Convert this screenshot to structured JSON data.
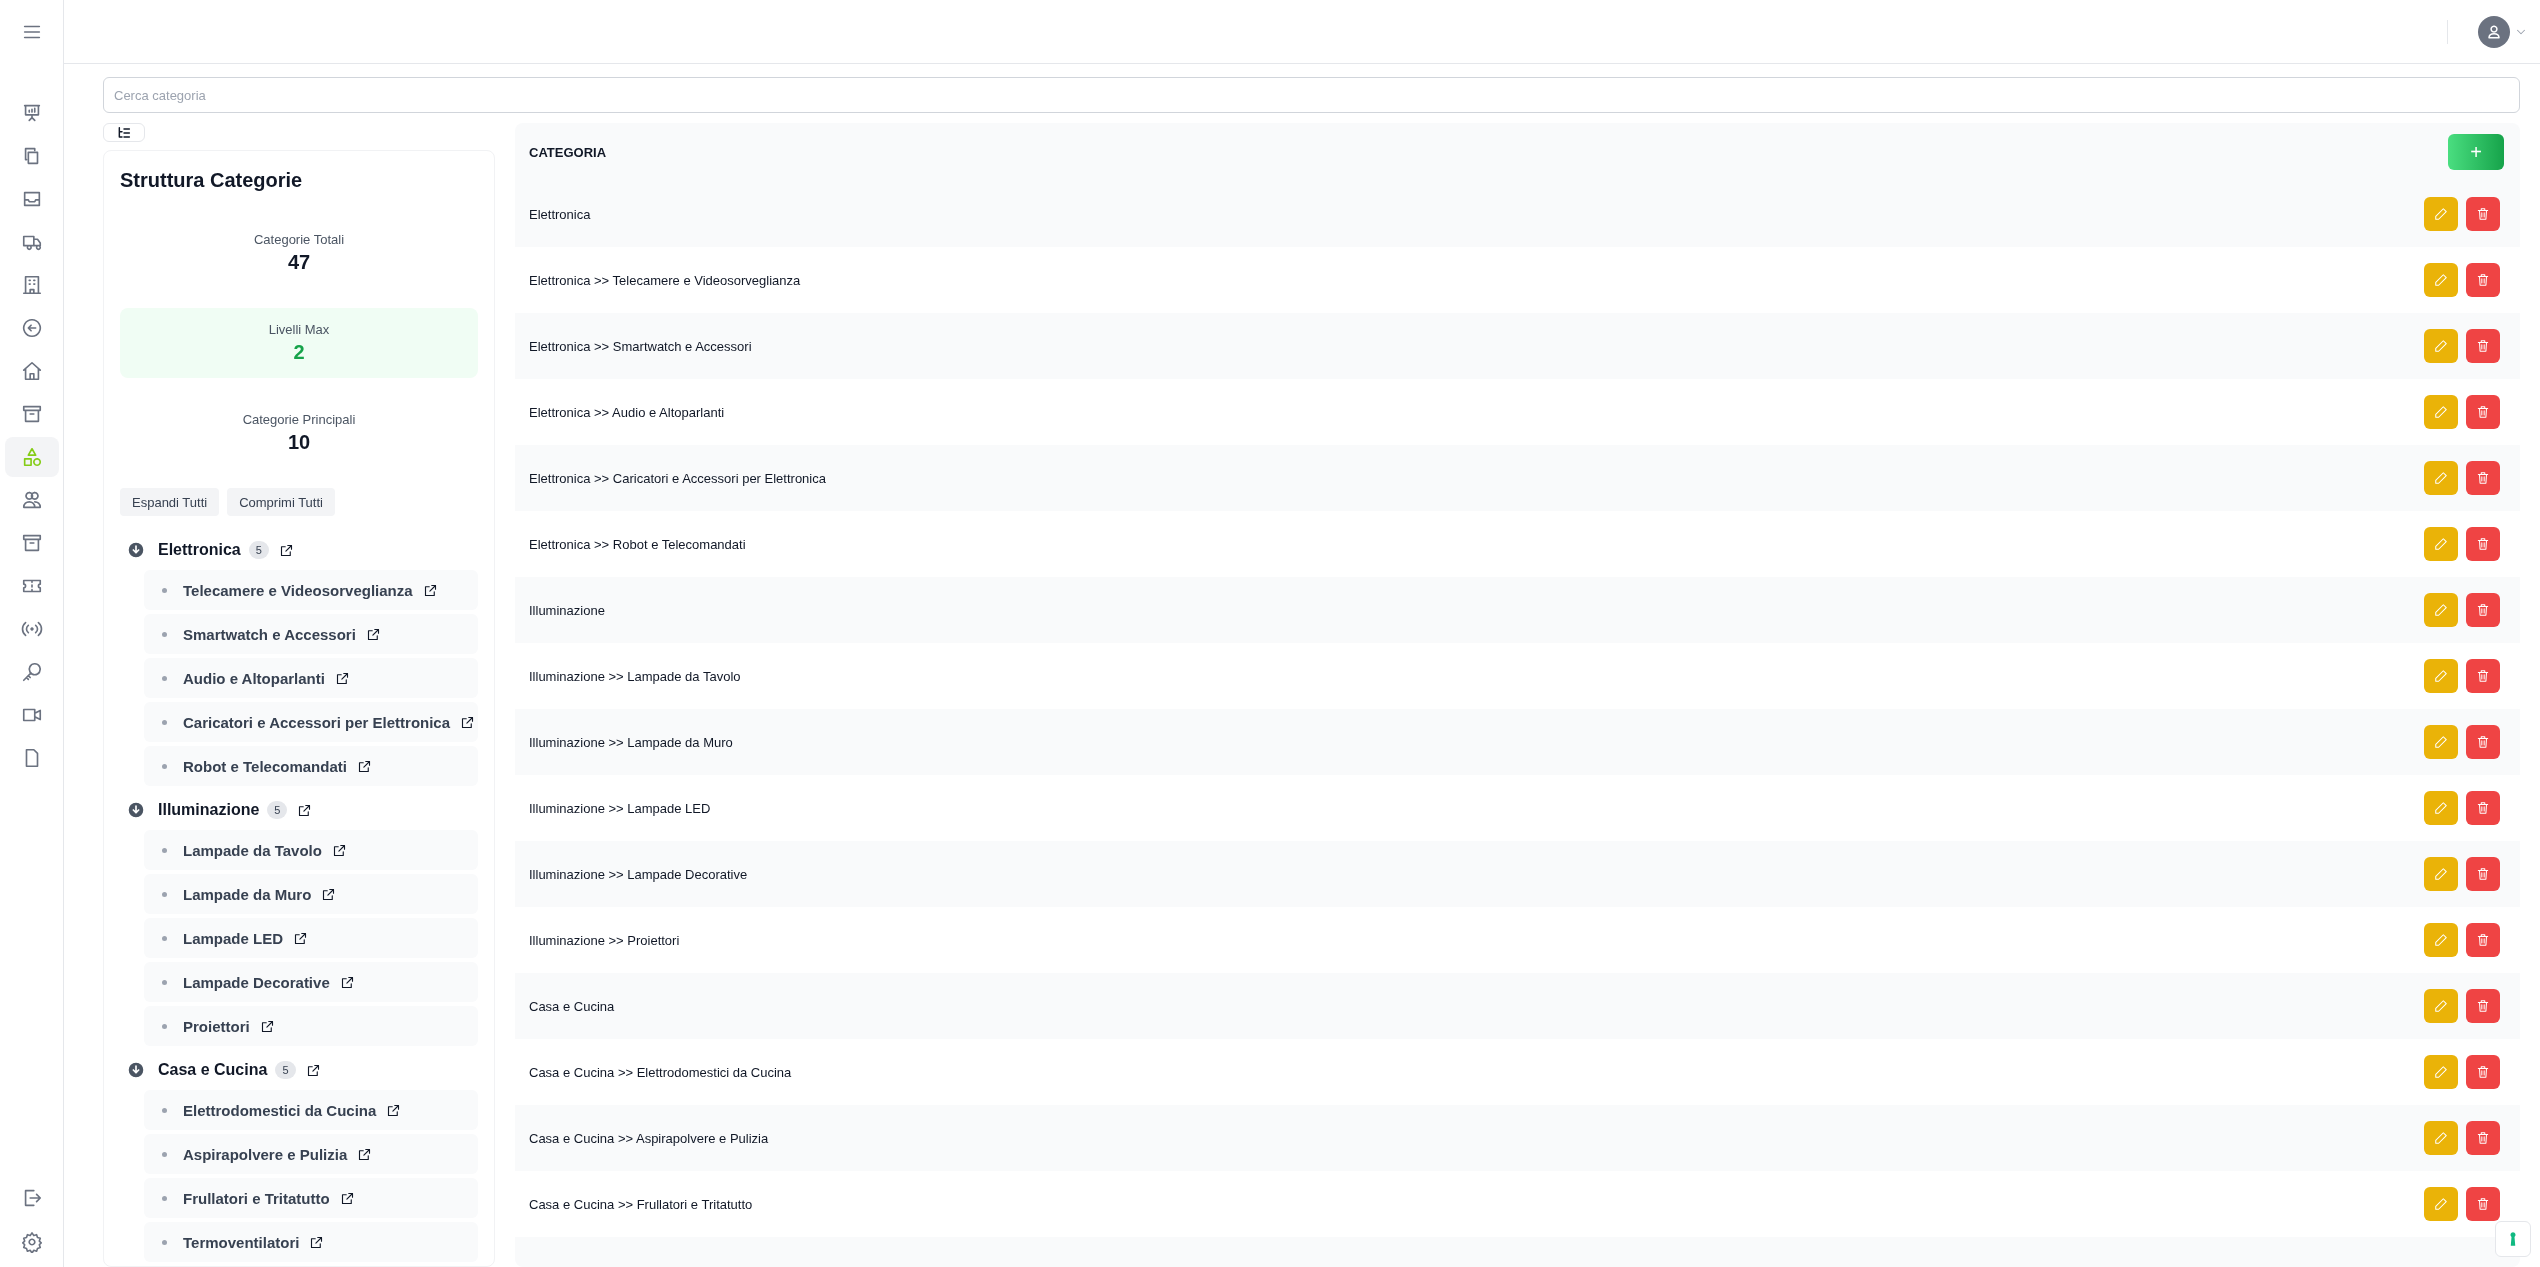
{
  "sidebar": {
    "items": [
      {
        "selected": false
      },
      {
        "selected": false
      },
      {
        "selected": false
      },
      {
        "selected": false
      },
      {
        "selected": false
      },
      {
        "selected": false
      },
      {
        "selected": false
      },
      {
        "selected": false
      },
      {
        "selected": true
      },
      {
        "selected": false
      },
      {
        "selected": false
      },
      {
        "selected": false
      },
      {
        "selected": false
      },
      {
        "selected": false
      },
      {
        "selected": false
      },
      {
        "selected": false
      }
    ]
  },
  "search": {
    "placeholder": "Cerca categoria"
  },
  "structure": {
    "title": "Struttura Categorie",
    "stats": [
      {
        "label": "Categorie Totali",
        "value": "47",
        "highlighted": false
      },
      {
        "label": "Livelli Max",
        "value": "2",
        "highlighted": true
      },
      {
        "label": "Categorie Principali",
        "value": "10",
        "highlighted": false
      }
    ],
    "buttons": [
      "Espandi Tutti",
      "Comprimi Tutti"
    ],
    "tree": [
      {
        "name": "Elettronica",
        "count": "5",
        "expanded": true,
        "children": [
          "Telecamere e Videosorveglianza",
          "Smartwatch e Accessori",
          "Audio e Altoparlanti",
          "Caricatori e Accessori per Elettronica",
          "Robot e Telecomandati"
        ]
      },
      {
        "name": "Illuminazione",
        "count": "5",
        "expanded": true,
        "children": [
          "Lampade da Tavolo",
          "Lampade da Muro",
          "Lampade LED",
          "Lampade Decorative",
          "Proiettori"
        ]
      },
      {
        "name": "Casa e Cucina",
        "count": "5",
        "expanded": true,
        "children": [
          "Elettrodomestici da Cucina",
          "Aspirapolvere e Pulizia",
          "Frullatori e Tritatutto",
          "Termoventilatori"
        ]
      }
    ]
  },
  "table": {
    "column": "CATEGORIA",
    "add_button": "+",
    "rows": [
      "Elettronica",
      "Elettronica >> Telecamere e Videosorveglianza",
      "Elettronica >> Smartwatch e Accessori",
      "Elettronica >> Audio e Altoparlanti",
      "Elettronica >> Caricatori e Accessori per Elettronica",
      "Elettronica >> Robot e Telecomandati",
      "Illuminazione",
      "Illuminazione >> Lampade da Tavolo",
      "Illuminazione >> Lampade da Muro",
      "Illuminazione >> Lampade LED",
      "Illuminazione >> Lampade Decorative",
      "Illuminazione >> Proiettori",
      "Casa e Cucina",
      "Casa e Cucina >> Elettrodomestici da Cucina",
      "Casa e Cucina >> Aspirapolvere e Pulizia",
      "Casa e Cucina >> Frullatori e Tritatutto"
    ]
  }
}
